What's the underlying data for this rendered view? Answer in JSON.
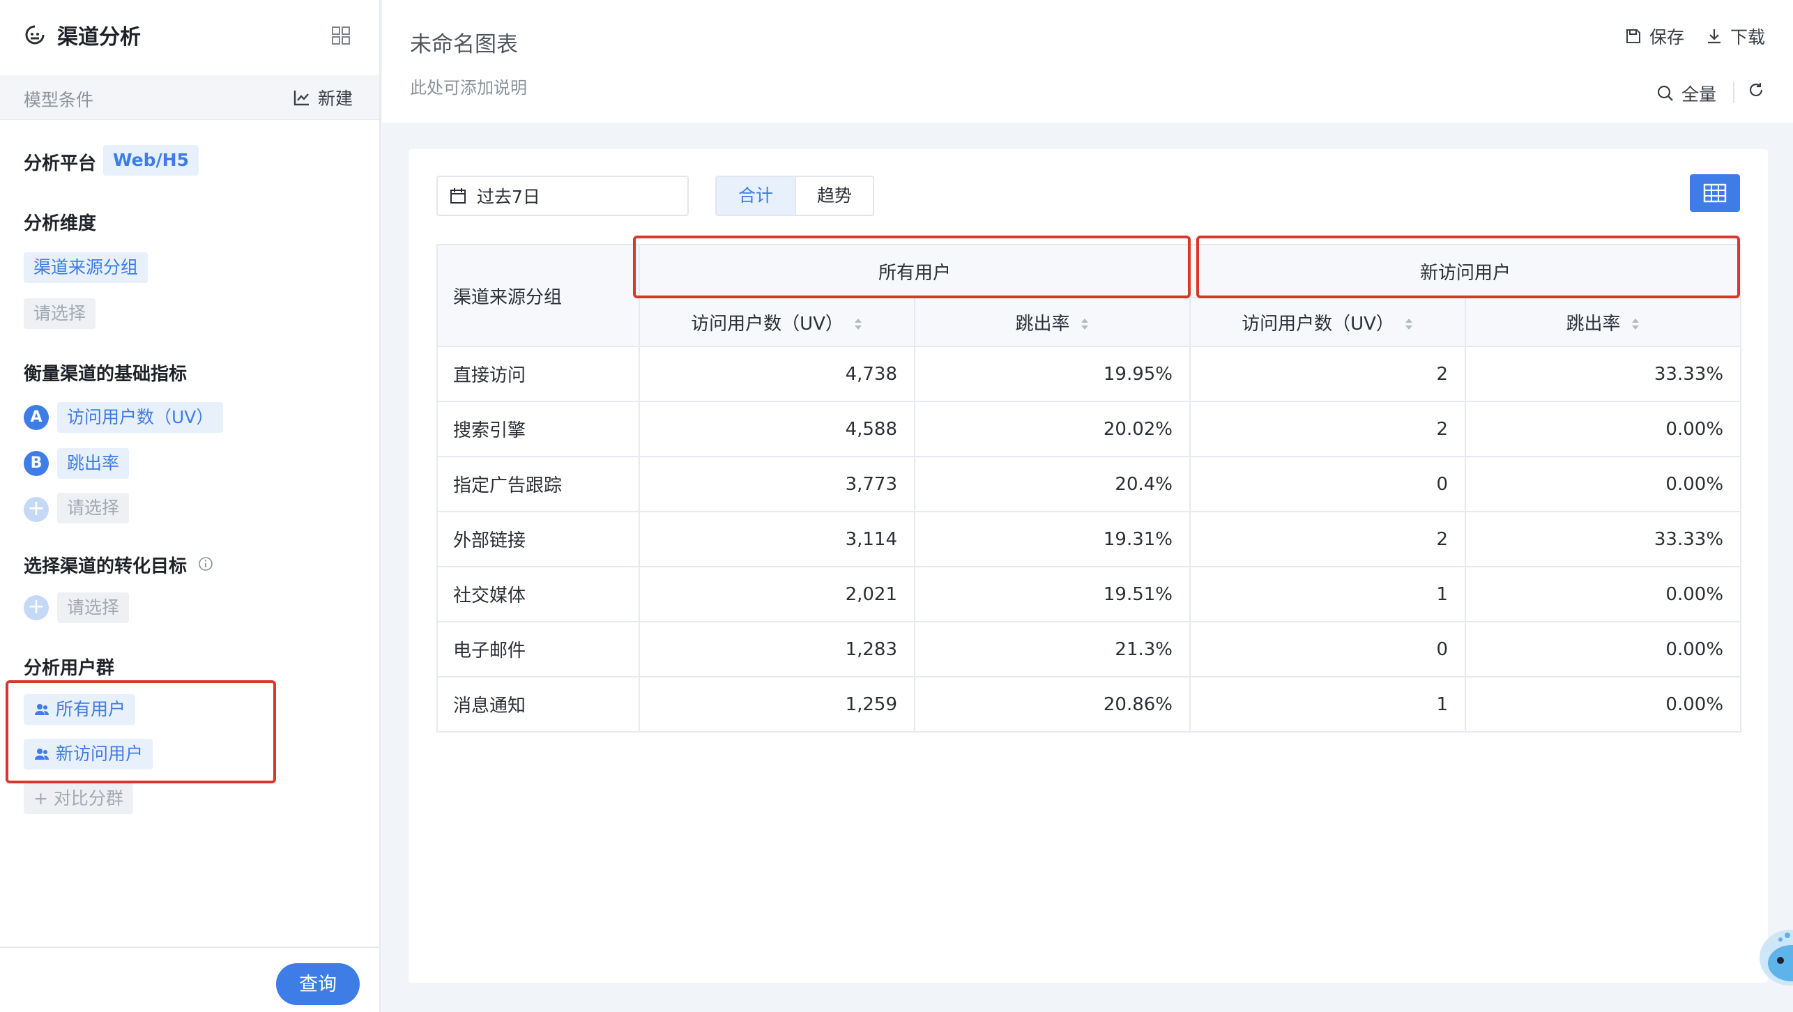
{
  "sidebar": {
    "title": "渠道分析",
    "subbar_label": "模型条件",
    "new_label": "新建",
    "platform": {
      "title": "分析平台",
      "value": "Web/H5"
    },
    "dimension": {
      "title": "分析维度",
      "selected": "渠道来源分组",
      "placeholder": "请选择"
    },
    "metrics": {
      "title": "衡量渠道的基础指标",
      "items": [
        {
          "badge": "A",
          "label": "访问用户数（UV）"
        },
        {
          "badge": "B",
          "label": "跳出率"
        }
      ],
      "add_placeholder": "请选择"
    },
    "goal": {
      "title": "选择渠道的转化目标",
      "add_placeholder": "请选择"
    },
    "segments": {
      "title": "分析用户群",
      "items": [
        "所有用户",
        "新访问用户"
      ],
      "compare_label": "+ 对比分群"
    },
    "query_label": "查询"
  },
  "header": {
    "chart_title": "未命名图表",
    "description": "此处可添加说明",
    "save_label": "保存",
    "download_label": "下载",
    "search_label": "全量"
  },
  "toolbar": {
    "date_range": "过去7日",
    "view_total": "合计",
    "view_trend": "趋势"
  },
  "colors": {
    "accent": "#3d7de5",
    "highlight": "#d9372d"
  },
  "table": {
    "row_header": "渠道来源分组",
    "groups": [
      "所有用户",
      "新访问用户"
    ],
    "sub_columns": [
      "访问用户数（UV）",
      "跳出率",
      "访问用户数（UV）",
      "跳出率"
    ],
    "rows": [
      {
        "name": "直接访问",
        "values": [
          "4,738",
          "19.95%",
          "2",
          "33.33%"
        ]
      },
      {
        "name": "搜索引擎",
        "values": [
          "4,588",
          "20.02%",
          "2",
          "0.00%"
        ]
      },
      {
        "name": "指定广告跟踪",
        "values": [
          "3,773",
          "20.4%",
          "0",
          "0.00%"
        ]
      },
      {
        "name": "外部链接",
        "values": [
          "3,114",
          "19.31%",
          "2",
          "33.33%"
        ]
      },
      {
        "name": "社交媒体",
        "values": [
          "2,021",
          "19.51%",
          "1",
          "0.00%"
        ]
      },
      {
        "name": "电子邮件",
        "values": [
          "1,283",
          "21.3%",
          "0",
          "0.00%"
        ]
      },
      {
        "name": "消息通知",
        "values": [
          "1,259",
          "20.86%",
          "1",
          "0.00%"
        ]
      }
    ]
  }
}
